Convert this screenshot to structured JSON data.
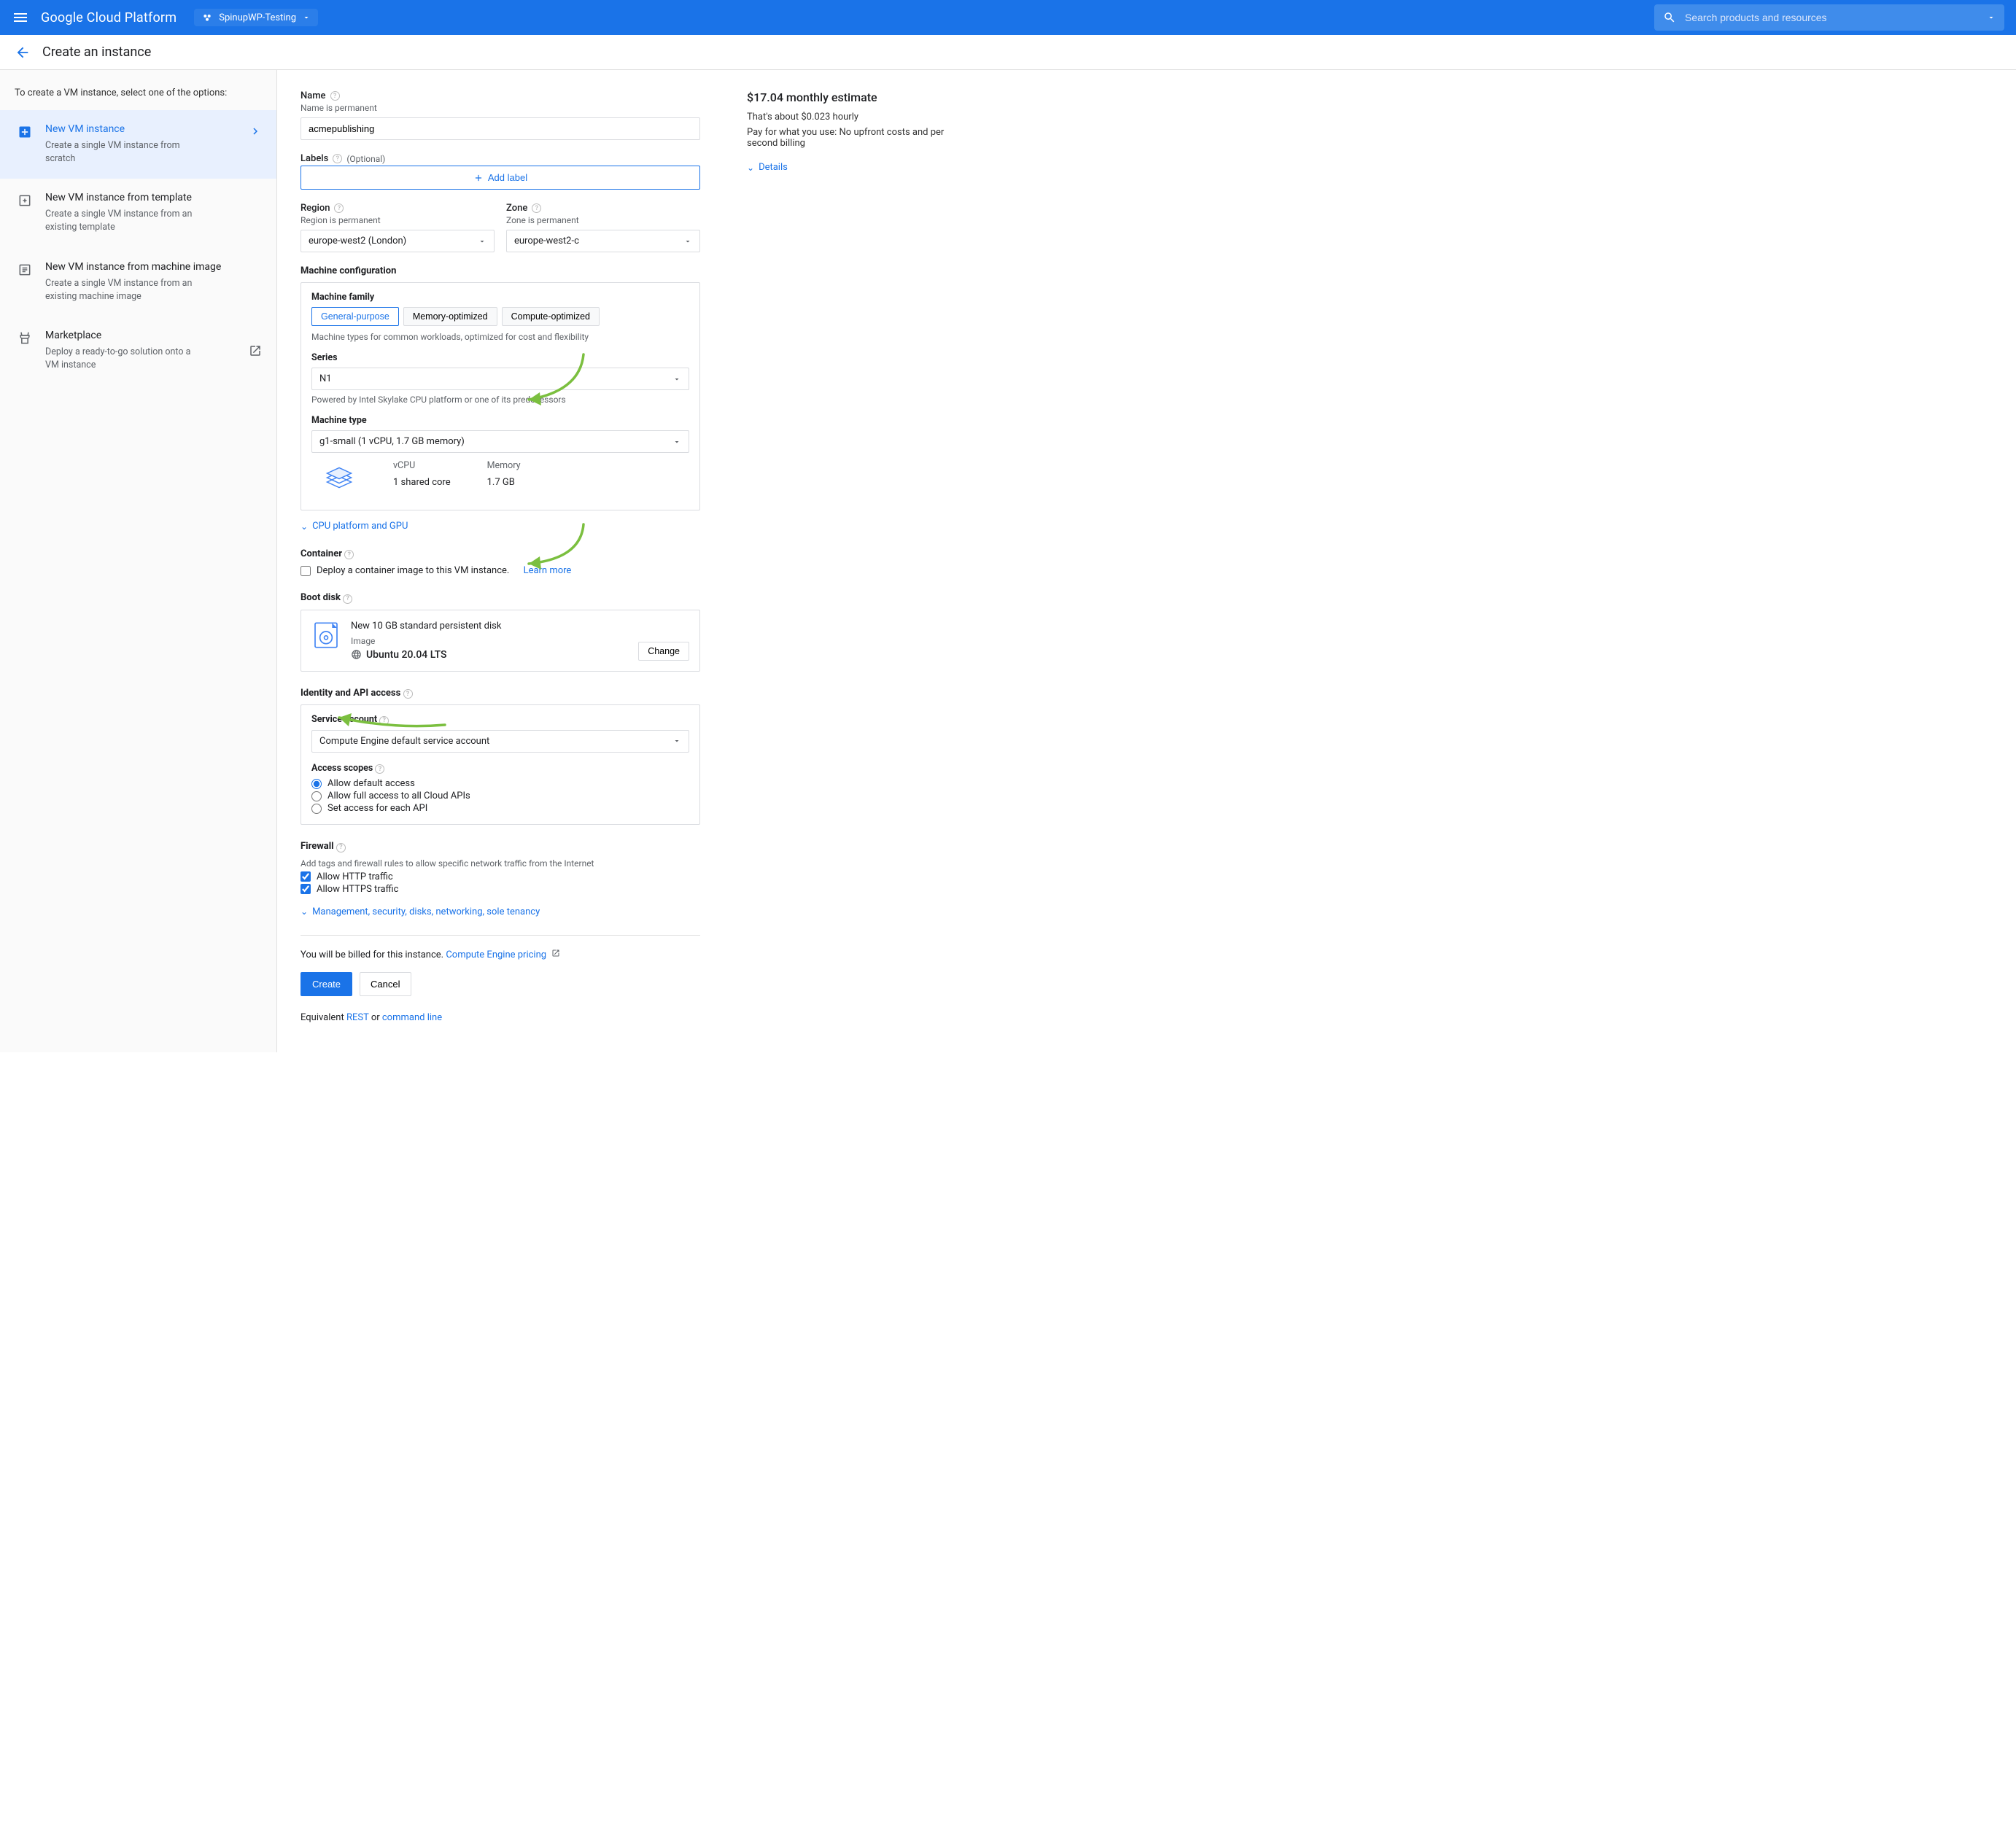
{
  "header": {
    "logo": "Google Cloud Platform",
    "project": "SpinupWP-Testing",
    "search_placeholder": "Search products and resources"
  },
  "page": {
    "title": "Create an instance",
    "sidebar_intro": "To create a VM instance, select one of the options:",
    "sidebar": [
      {
        "title": "New VM instance",
        "desc": "Create a single VM instance from scratch",
        "active": true
      },
      {
        "title": "New VM instance from template",
        "desc": "Create a single VM instance from an existing template"
      },
      {
        "title": "New VM instance from machine image",
        "desc": "Create a single VM instance from an existing machine image"
      },
      {
        "title": "Marketplace",
        "desc": "Deploy a ready-to-go solution onto a VM instance",
        "ext": true
      }
    ]
  },
  "form": {
    "name_label": "Name",
    "name_hint": "Name is permanent",
    "name_value": "acmepublishing",
    "labels_label": "Labels",
    "optional_text": "(Optional)",
    "add_label_btn": "Add label",
    "region_label": "Region",
    "region_hint": "Region is permanent",
    "region_value": "europe-west2 (London)",
    "zone_label": "Zone",
    "zone_hint": "Zone is permanent",
    "zone_value": "europe-west2-c",
    "machine_config_title": "Machine configuration",
    "machine_family_label": "Machine family",
    "family_tabs": [
      "General-purpose",
      "Memory-optimized",
      "Compute-optimized"
    ],
    "family_desc": "Machine types for common workloads, optimized for cost and flexibility",
    "series_label": "Series",
    "series_value": "N1",
    "series_desc": "Powered by Intel Skylake CPU platform or one of its predecessors",
    "machine_type_label": "Machine type",
    "machine_type_value": "g1-small (1 vCPU, 1.7 GB memory)",
    "spec": {
      "vcpu_label": "vCPU",
      "vcpu_value": "1 shared core",
      "mem_label": "Memory",
      "mem_value": "1.7 GB"
    },
    "cpu_expand": "CPU platform and GPU",
    "container_title": "Container",
    "container_text": "Deploy a container image to this VM instance.",
    "container_learn": "Learn more",
    "boot_title": "Boot disk",
    "boot_disk_line": "New 10 GB standard persistent disk",
    "boot_image_label": "Image",
    "boot_os": "Ubuntu 20.04 LTS",
    "change_btn": "Change",
    "identity_title": "Identity and API access",
    "service_account_label": "Service account",
    "service_account_value": "Compute Engine default service account",
    "scopes_label": "Access scopes",
    "scopes": [
      "Allow default access",
      "Allow full access to all Cloud APIs",
      "Set access for each API"
    ],
    "firewall_title": "Firewall",
    "firewall_desc": "Add tags and firewall rules to allow specific network traffic from the Internet",
    "firewall_http": "Allow HTTP traffic",
    "firewall_https": "Allow HTTPS traffic",
    "mgmt_expand": "Management, security, disks, networking, sole tenancy",
    "billing_prefix": "You will be billed for this instance. ",
    "billing_link": "Compute Engine pricing",
    "create_btn": "Create",
    "cancel_btn": "Cancel",
    "equivalent": {
      "prefix": "Equivalent ",
      "rest": "REST",
      "or": " or ",
      "cl": "command line"
    }
  },
  "estimate": {
    "monthly": "$17.04 monthly estimate",
    "hourly": "That's about $0.023 hourly",
    "note": "Pay for what you use: No upfront costs and per second billing",
    "details": "Details"
  }
}
